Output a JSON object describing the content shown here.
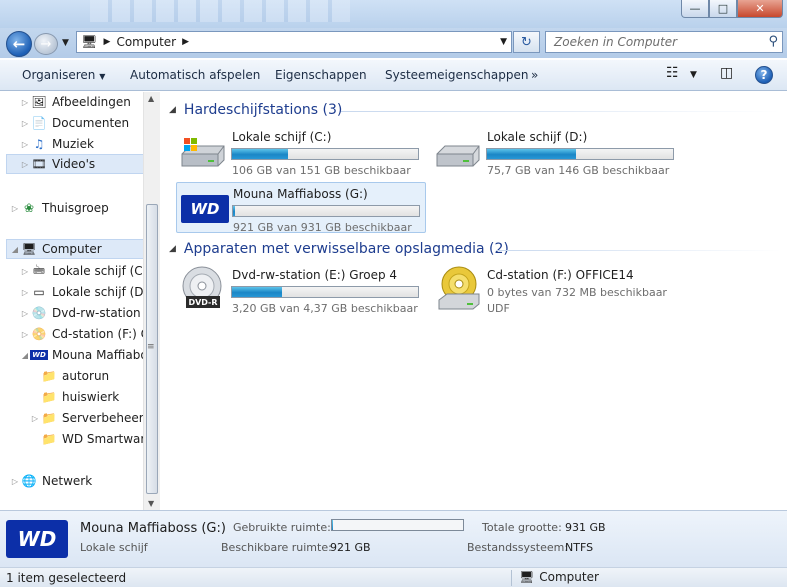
{
  "address": {
    "crumb": "Computer"
  },
  "search": {
    "placeholder": "Zoeken in Computer"
  },
  "toolbar": {
    "organize": "Organiseren",
    "autoplay": "Automatisch afspelen",
    "properties": "Eigenschappen",
    "system_properties": "Systeemeigenschappen",
    "more": "»"
  },
  "nav": {
    "libraries": [
      {
        "label": "Afbeeldingen",
        "icon": "pictures-icon"
      },
      {
        "label": "Documenten",
        "icon": "documents-icon"
      },
      {
        "label": "Muziek",
        "icon": "music-icon"
      },
      {
        "label": "Video's",
        "icon": "videos-icon"
      }
    ],
    "homegroup": "Thuisgroep",
    "computer": "Computer",
    "computer_items": [
      {
        "label": "Lokale schijf (C:)",
        "icon": "drive-c-icon"
      },
      {
        "label": "Lokale schijf (D:)",
        "icon": "drive-d-icon"
      },
      {
        "label": "Dvd-rw-station (",
        "icon": "dvd-drive-icon"
      },
      {
        "label": "Cd-station (F:) O",
        "icon": "cd-drive-icon"
      },
      {
        "label": "Mouna Maffiaboo",
        "icon": "wd-drive-icon"
      }
    ],
    "folders": [
      {
        "label": "autorun"
      },
      {
        "label": "huiswierk"
      },
      {
        "label": "Serverbeheer"
      },
      {
        "label": "WD Smartware"
      }
    ],
    "network": "Netwerk"
  },
  "groups": {
    "hdd_title": "Hardeschijfstations (3)",
    "removable_title": "Apparaten met verwisselbare opslagmedia (2)"
  },
  "drives": [
    {
      "name": "Lokale schijf (C:)",
      "info": "106 GB van 151 GB beschikbaar",
      "used_fraction": 0.3
    },
    {
      "name": "Lokale schijf (D:)",
      "info": "75,7 GB van 146 GB beschikbaar",
      "used_fraction": 0.48
    },
    {
      "name": "Mouna Maffiaboss (G:)",
      "info": "921 GB van 931 GB beschikbaar",
      "used_fraction": 0.01,
      "logo": "WD"
    }
  ],
  "removable": [
    {
      "name": "Dvd-rw-station (E:) Groep 4",
      "info": "3,20 GB van 4,37 GB beschikbaar",
      "used_fraction": 0.27,
      "label": "DVD-R"
    },
    {
      "name": "Cd-station (F:) OFFICE14",
      "info": "0 bytes van 732 MB beschikbaar",
      "info2": "UDF"
    }
  ],
  "details": {
    "logo": "WD",
    "name": "Mouna Maffiaboss (G:)",
    "type": "Lokale schijf",
    "used_label": "Gebruikte ruimte:",
    "used_fraction": 0.01,
    "free_label": "Beschikbare ruimte:",
    "free_value": "921 GB",
    "total_label": "Totale grootte:",
    "total_value": "931 GB",
    "fs_label": "Bestandssysteem:",
    "fs_value": "NTFS"
  },
  "status": {
    "selected": "1 item geselecteerd",
    "location": "Computer"
  },
  "colors": {
    "accent": "#1e3d8f",
    "bar_fill": "#1b86c6",
    "wd_blue": "#0c2fa8"
  }
}
